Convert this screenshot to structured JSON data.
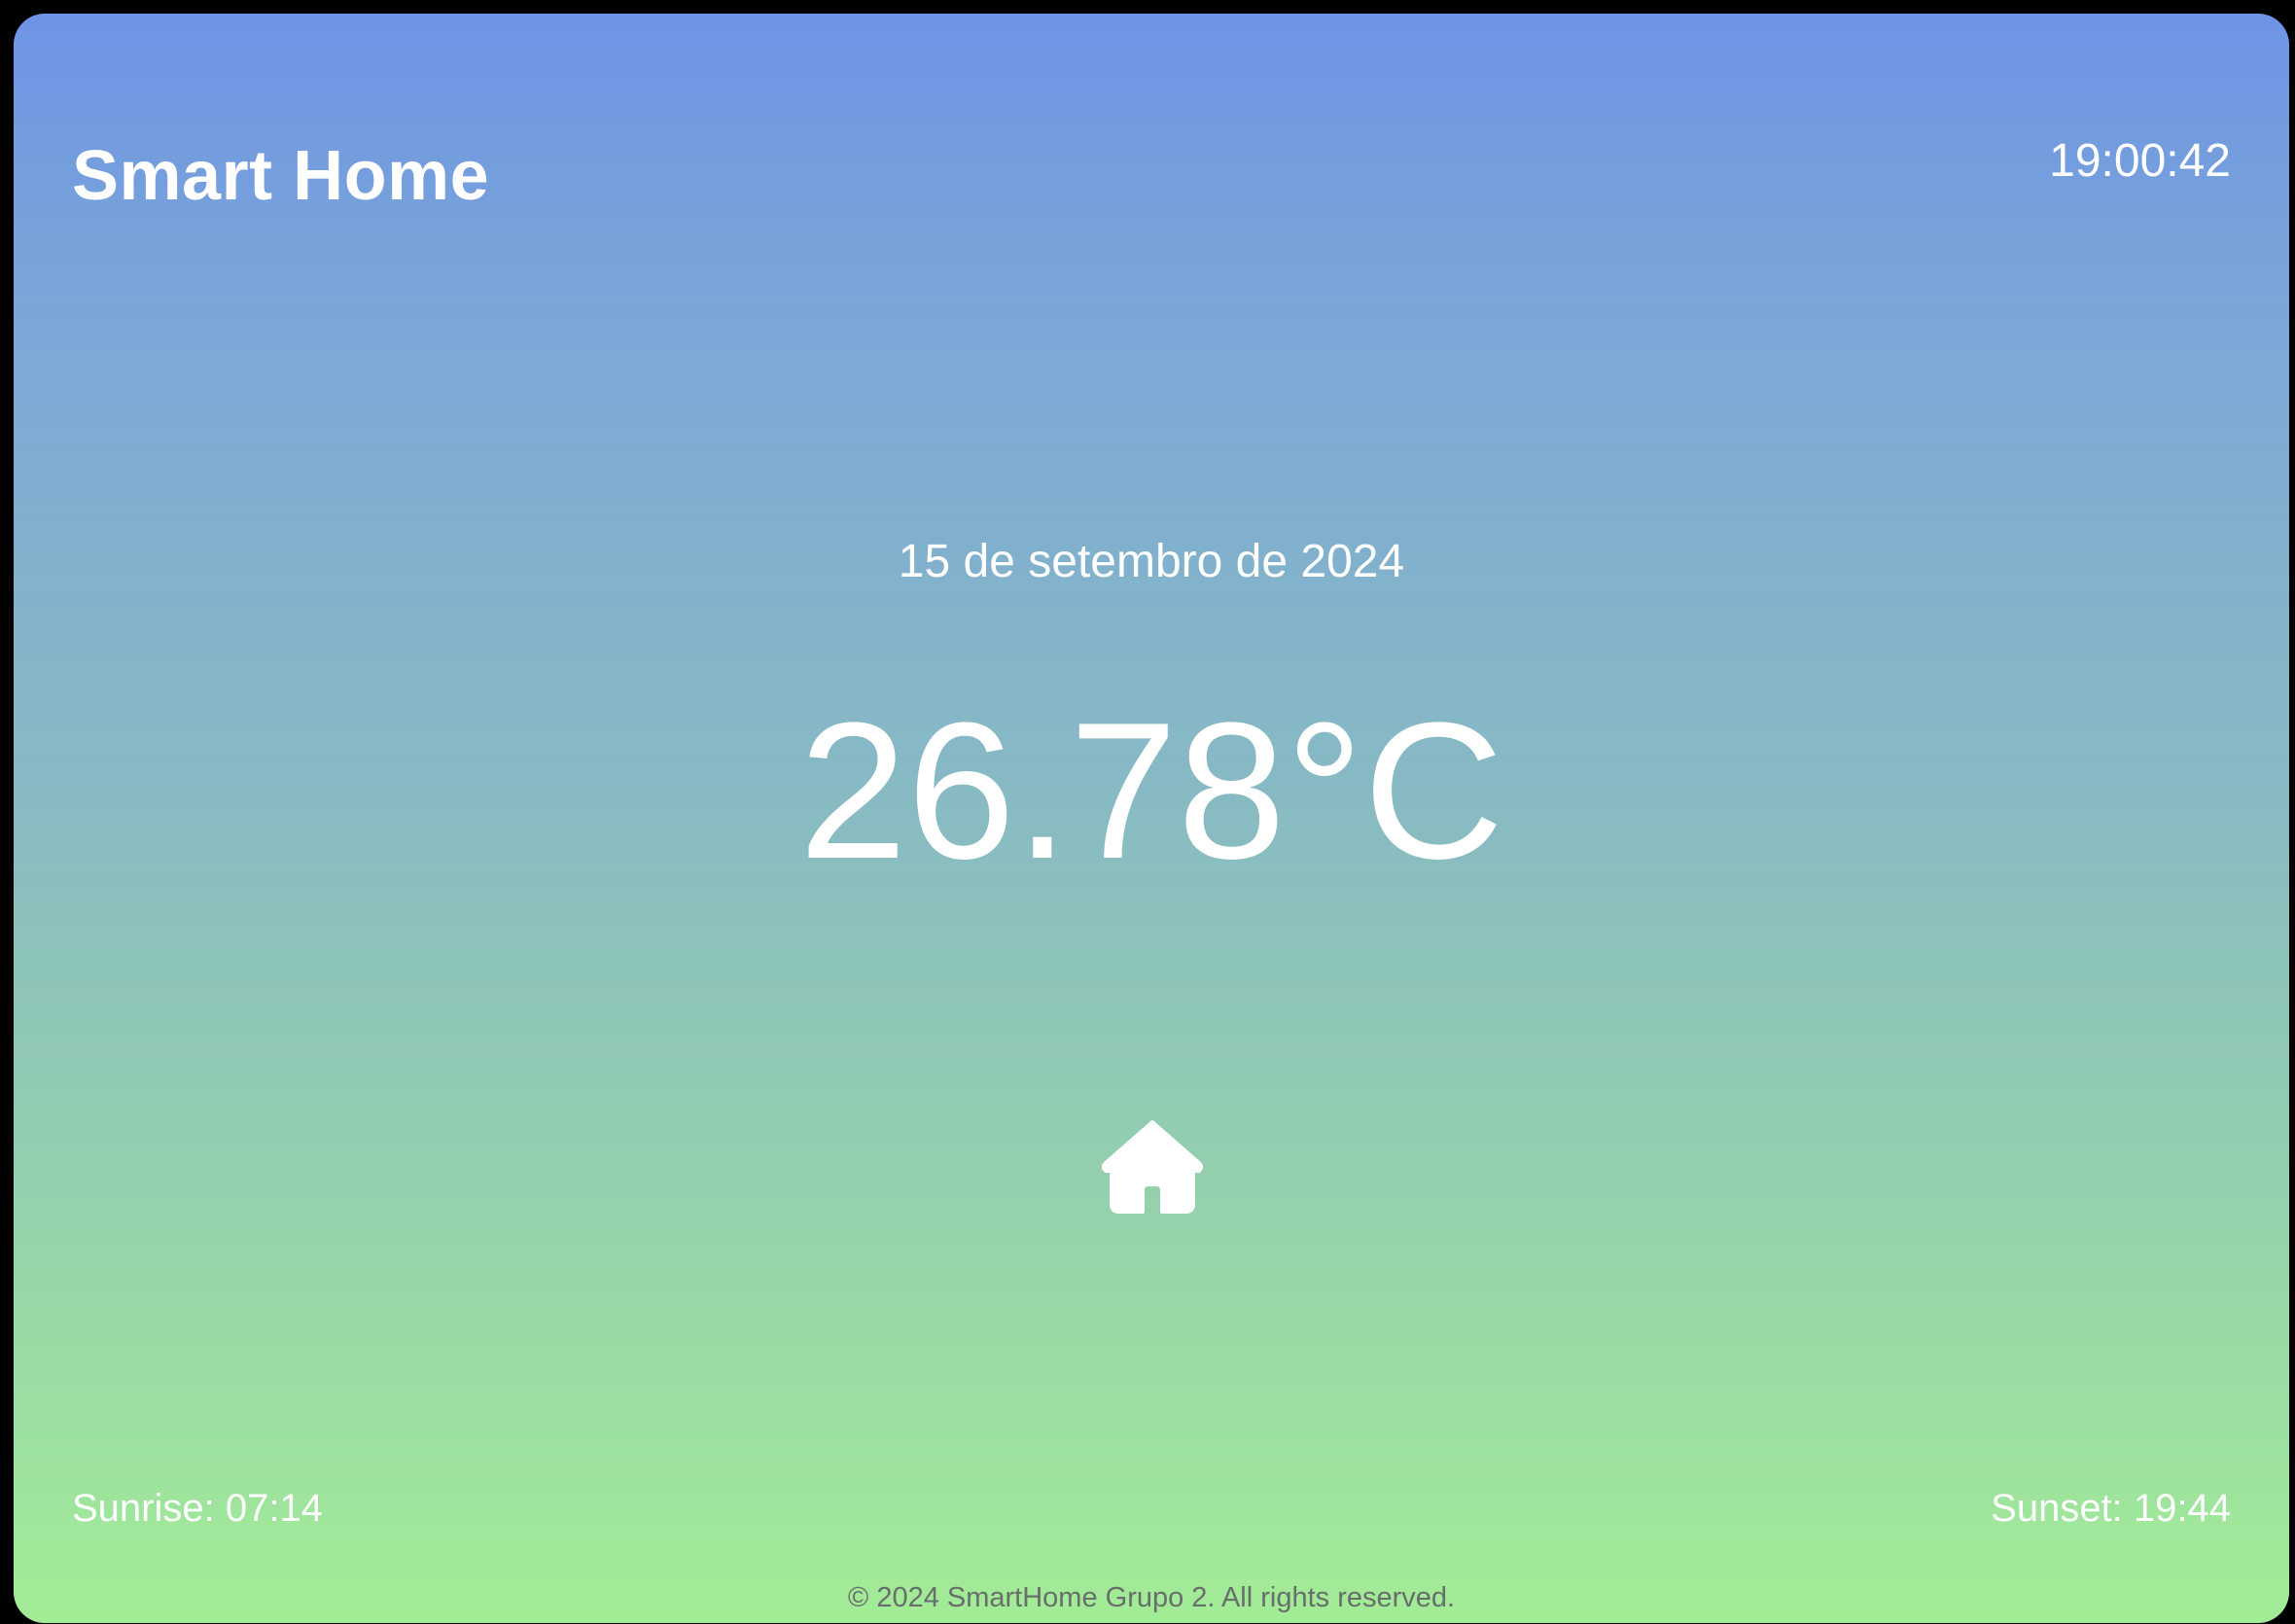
{
  "header": {
    "title": "Smart Home",
    "clock": "19:00:42"
  },
  "main": {
    "date": "15 de setembro de 2024",
    "temperature": "26.78°C",
    "icon": "home-icon"
  },
  "sun": {
    "sunrise": "Sunrise: 07:14",
    "sunset": "Sunset: 19:44"
  },
  "footer": {
    "copyright": "© 2024 SmartHome Grupo 2. All rights reserved."
  },
  "colors": {
    "gradient_top": "#6e94e5",
    "gradient_bottom": "#a3ec96",
    "text": "#ffffff",
    "footer_text": "#666f6a",
    "frame": "#000000"
  }
}
